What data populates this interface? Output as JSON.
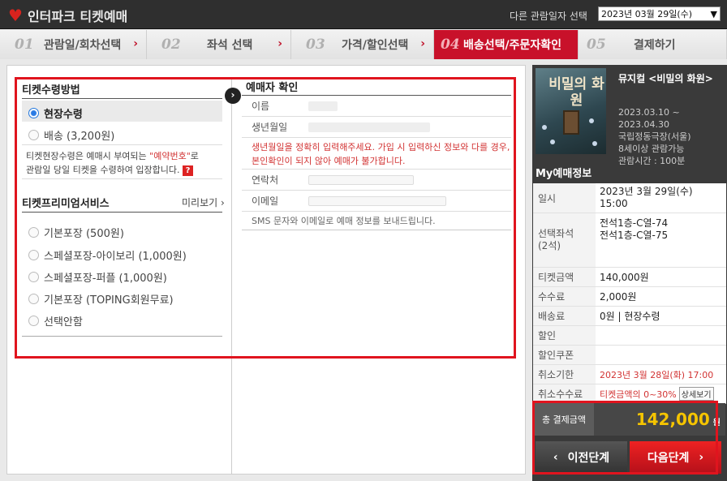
{
  "header": {
    "logo": "인터파크 티켓예매",
    "date_label": "다른 관람일자 선택",
    "date_value": "2023년 03월 29일(수)"
  },
  "steps": [
    {
      "num": "01",
      "label": "관람일/회차선택"
    },
    {
      "num": "02",
      "label": "좌석 선택"
    },
    {
      "num": "03",
      "label": "가격/할인선택"
    },
    {
      "num": "04",
      "label": "배송선택/주문자확인"
    },
    {
      "num": "05",
      "label": "결제하기"
    }
  ],
  "ticket_method": {
    "title": "티켓수령방법",
    "options": [
      "현장수령",
      "배송 (3,200원)"
    ],
    "note_prefix": "티켓현장수령은 예매시 부여되는 ",
    "note_highlight": "\"예약번호\"",
    "note_mid": "로",
    "note_line2": "관람일 당일 티켓을 수령하여 입장합니다."
  },
  "premium": {
    "title": "티켓프리미엄서비스",
    "preview": "미리보기 ›",
    "options": [
      "기본포장 (500원)",
      "스페셜포장-아이보리 (1,000원)",
      "스페셜포장-퍼플 (1,000원)",
      "기본포장 (TOPING회원무료)",
      "선택안함"
    ]
  },
  "booker": {
    "title": "예매자 확인",
    "name_label": "이름",
    "birth_label": "생년월일",
    "warning_line1": "생년월일을 정확히 입력해주세요. 가입 시 입력하신 정보와 다를 경우,",
    "warning_line2": "본인확인이 되지 않아 예매가 불가합니다.",
    "phone_label": "연락처",
    "email_label": "이메일",
    "sms_note": "SMS 문자와 이메일로 예매 정보를 보내드립니다."
  },
  "show": {
    "poster_title": "비밀의 화원",
    "title": "뮤지컬 <비밀의 화원>",
    "period1": "2023.03.10 ~",
    "period2": "2023.04.30",
    "venue": "국립정동극장(서울)",
    "age": "8세이상 관람가능",
    "runtime": "관람시간 : 100분"
  },
  "my_info": {
    "title": "My예매정보",
    "date_label": "일시",
    "date_value1": "2023년 3월 29일(수)",
    "date_value2": "15:00",
    "seat_label1": "선택좌석",
    "seat_label2": "(2석)",
    "seat1": "전석1층-C열-74",
    "seat2": "전석1층-C열-75",
    "ticket_price_label": "티켓금액",
    "ticket_price": "140,000원",
    "fee_label": "수수료",
    "fee": "2,000원",
    "delivery_label": "배송료",
    "delivery": "0원 | 현장수령",
    "discount_label": "할인",
    "discount": "",
    "coupon_label": "할인쿠폰",
    "coupon": "",
    "cancel_deadline_label": "취소기한",
    "cancel_deadline": "2023년 3월 28일(화) 17:00",
    "cancel_fee_label": "취소수수료",
    "cancel_fee": "티켓금액의 0~30%",
    "detail_btn": "상세보기"
  },
  "total": {
    "label": "총 결제금액",
    "amount": "142,000",
    "unit": "원"
  },
  "buttons": {
    "prev": "이전단계",
    "next": "다음단계"
  }
}
